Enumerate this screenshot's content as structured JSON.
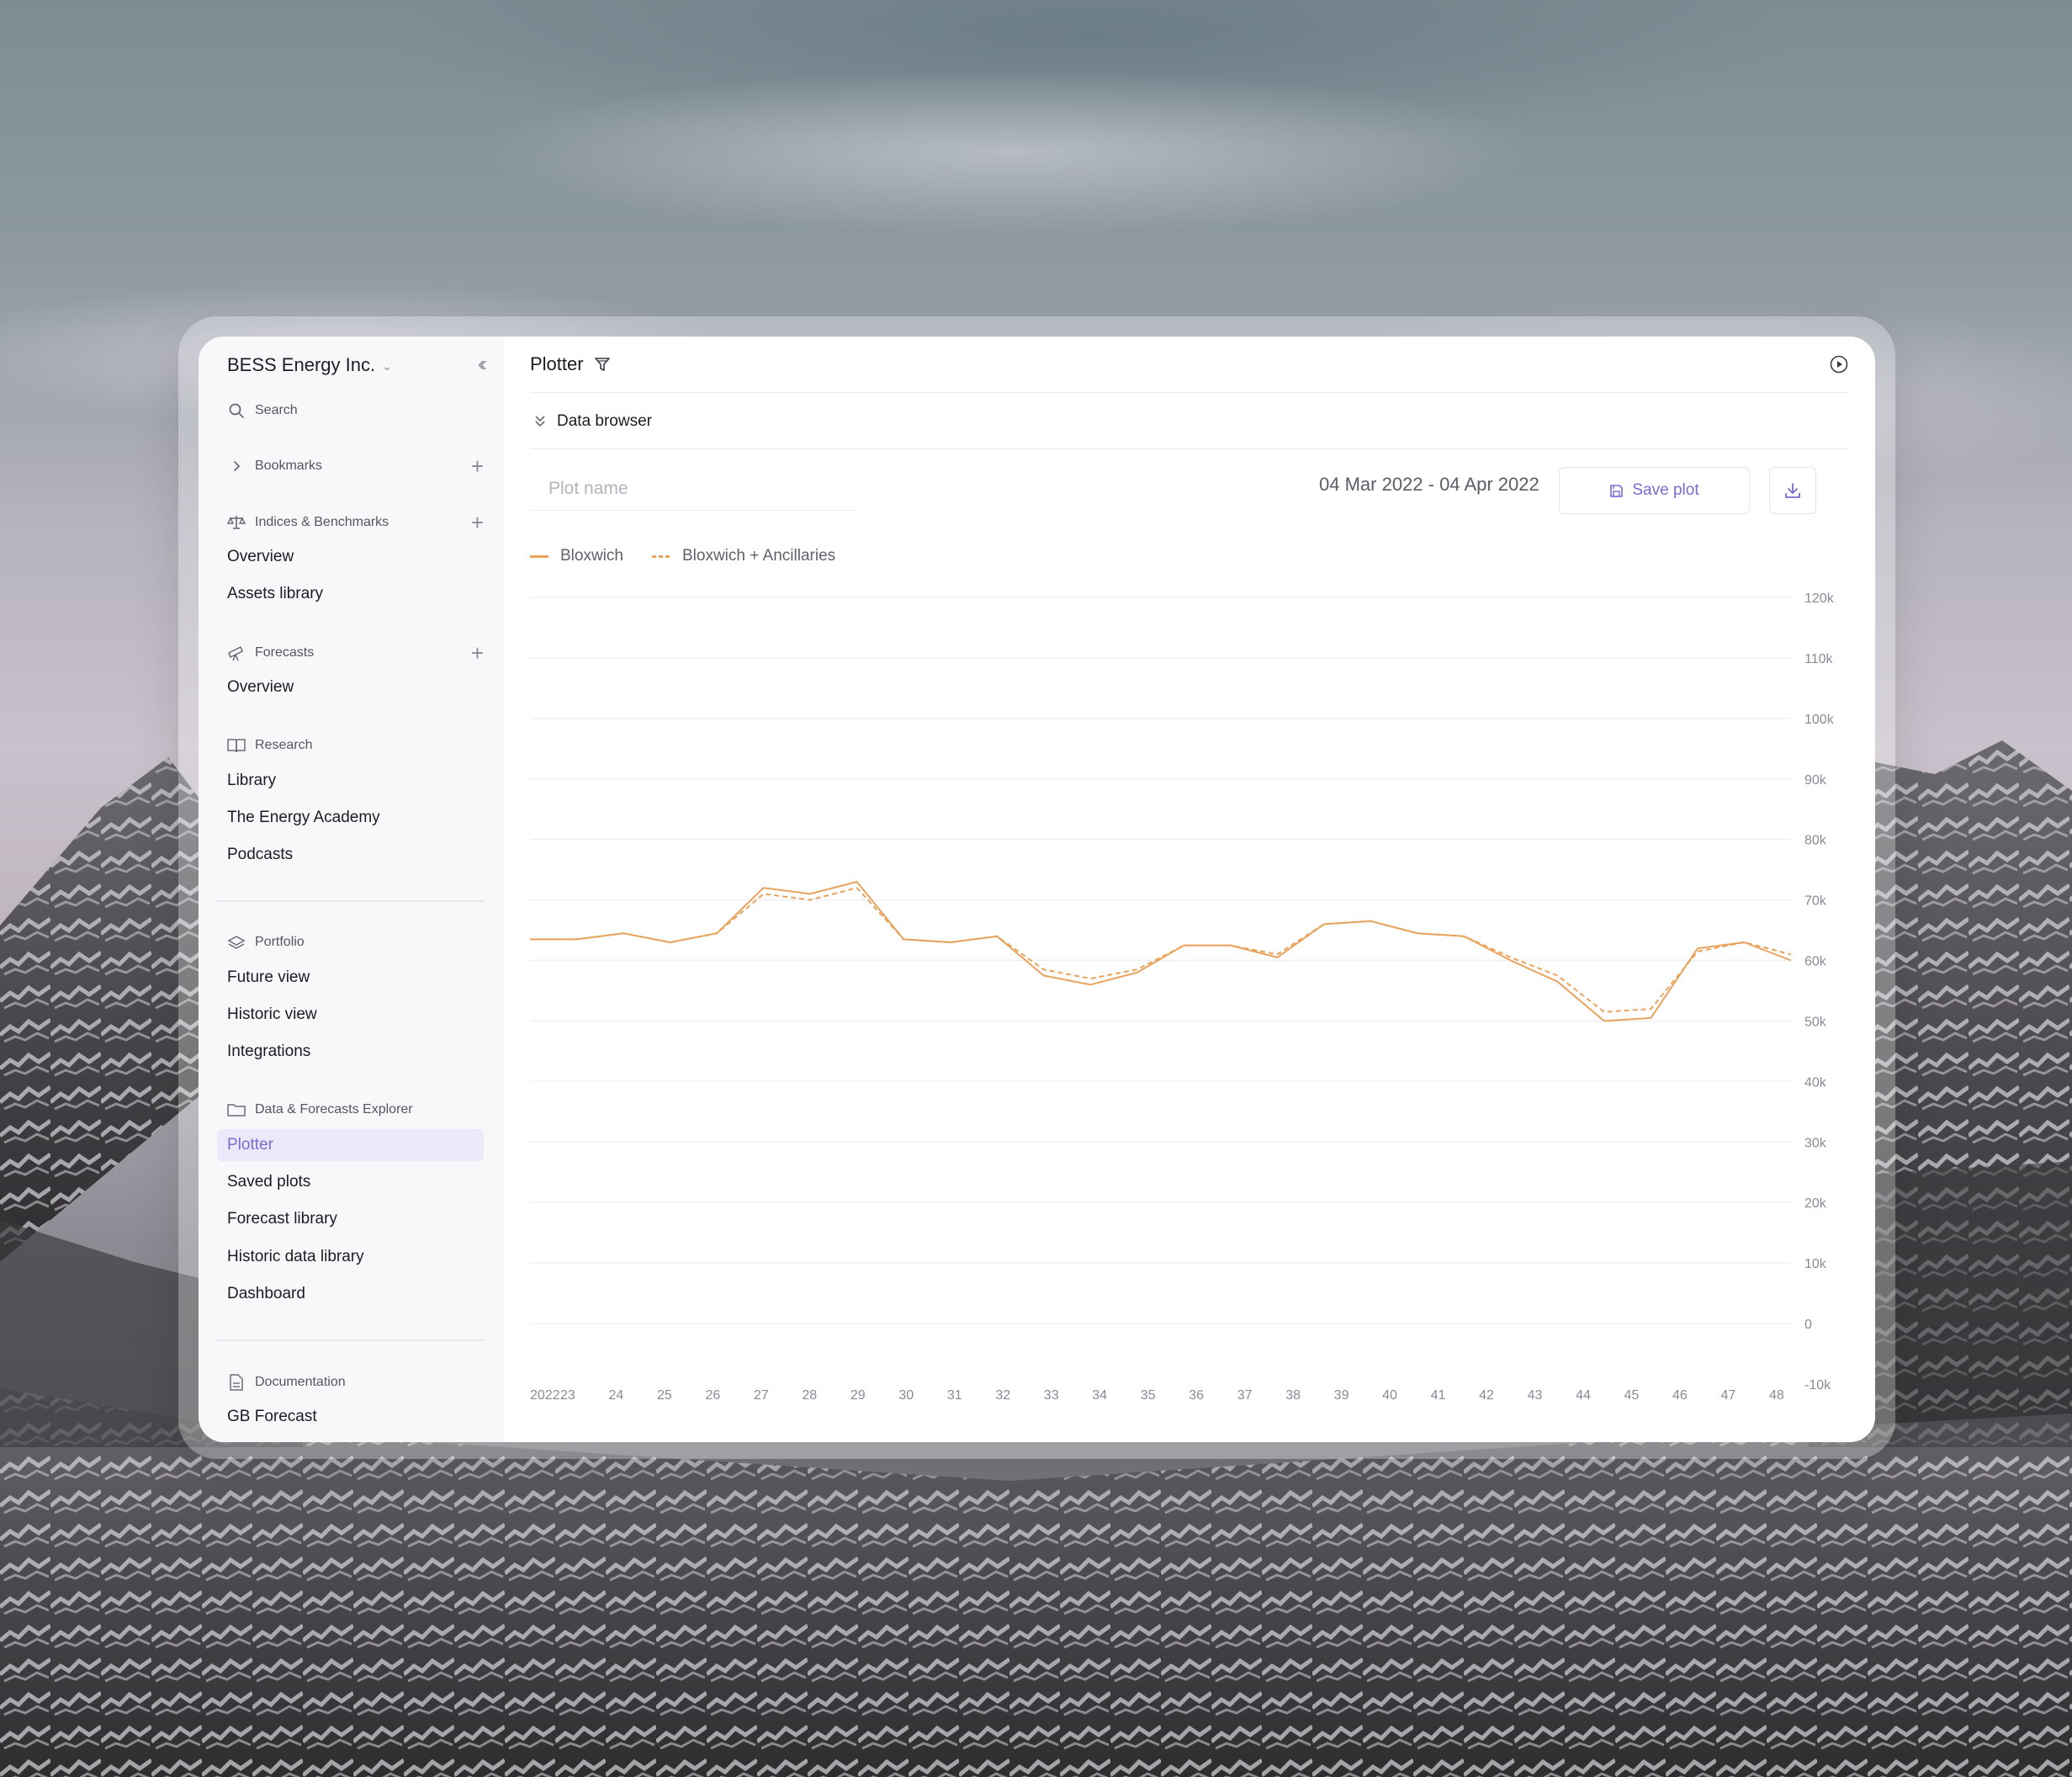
{
  "workspace": {
    "name": "BESS Energy Inc."
  },
  "sidebar": {
    "search_label": "Search",
    "bookmarks_label": "Bookmarks",
    "sections": {
      "indices": {
        "label": "Indices & Benchmarks",
        "items": [
          "Overview",
          "Assets library"
        ]
      },
      "forecasts": {
        "label": "Forecasts",
        "items": [
          "Overview"
        ]
      },
      "research": {
        "label": "Research",
        "items": [
          "Library",
          "The Energy Academy",
          "Podcasts"
        ]
      },
      "portfolio": {
        "label": "Portfolio",
        "items": [
          "Future view",
          "Historic view",
          "Integrations"
        ]
      },
      "explorer": {
        "label": "Data & Forecasts Explorer",
        "items": [
          "Plotter",
          "Saved plots",
          "Forecast library",
          "Historic data library",
          "Dashboard"
        ],
        "active": "Plotter"
      },
      "documentation": {
        "label": "Documentation",
        "items": [
          "GB Forecast"
        ]
      }
    }
  },
  "header": {
    "title": "Plotter"
  },
  "data_browser": {
    "label": "Data browser"
  },
  "toolbar": {
    "plot_name_placeholder": "Plot name",
    "date_range": "04 Mar 2022 - 04 Apr 2022",
    "save_label": "Save plot"
  },
  "colors": {
    "accent": "#7b6ad2",
    "series": "#e8a45c",
    "active_bg": "#ece8fa"
  },
  "chart_data": {
    "type": "line",
    "x": [
      "2022",
      "23",
      "24",
      "25",
      "26",
      "27",
      "28",
      "29",
      "30",
      "31",
      "32",
      "33",
      "34",
      "35",
      "36",
      "37",
      "38",
      "39",
      "40",
      "41",
      "42",
      "43",
      "44",
      "45",
      "46",
      "47",
      "48"
    ],
    "x_start_label": "2022",
    "series": [
      {
        "name": "Bloxwich",
        "style": "solid",
        "values": [
          63500,
          63500,
          64500,
          63000,
          64500,
          72000,
          71000,
          73000,
          63500,
          63000,
          64000,
          57500,
          56000,
          58000,
          62500,
          62500,
          60500,
          66000,
          66500,
          64500,
          64000,
          60000,
          56500,
          50000,
          50500,
          62000,
          63000,
          60000
        ]
      },
      {
        "name": "Bloxwich + Ancillaries",
        "style": "dashed",
        "values": [
          63500,
          63500,
          64500,
          63000,
          64500,
          71000,
          70000,
          72000,
          63500,
          63000,
          64000,
          58500,
          57000,
          58500,
          62500,
          62500,
          61000,
          66000,
          66500,
          64500,
          64000,
          60500,
          57500,
          51500,
          52000,
          61500,
          63000,
          61000
        ]
      }
    ],
    "y_ticks": [
      "120k",
      "110k",
      "100k",
      "90k",
      "80k",
      "70k",
      "60k",
      "50k",
      "40k",
      "30k",
      "20k",
      "10k",
      "0",
      "-10k"
    ],
    "ylim": [
      -10000,
      120000
    ],
    "grid": true,
    "legend": "top-left",
    "y_axis_side": "right"
  }
}
